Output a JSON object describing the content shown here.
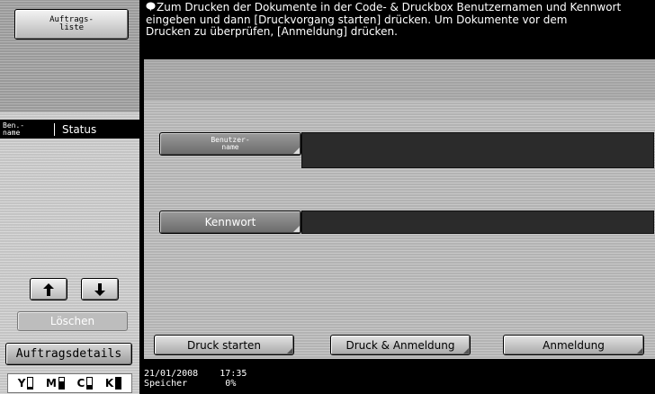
{
  "left_panel": {
    "job_list_button": "Auftrags-\nliste",
    "list_header": {
      "col1": "Ben.-\nname",
      "col2": "Status"
    },
    "delete_button": "Löschen",
    "details_button": "Auftragsdetails",
    "toner": [
      {
        "label": "Y",
        "level": 0.2
      },
      {
        "label": "M",
        "level": 0.65
      },
      {
        "label": "C",
        "level": 0.3
      },
      {
        "label": "K",
        "level": 1.0
      }
    ]
  },
  "message": {
    "text": "Zum Drucken der Dokumente in der Code- & Druckbox Benutzernamen und Kennwort\neingeben und dann [Druckvorgang starten] drücken. Um Dokumente vor dem\nDrucken zu überprüfen, [Anmeldung] drücken."
  },
  "form": {
    "username_label": "Benutzer-\nname",
    "username_value": "",
    "password_label": "Kennwort",
    "password_value": ""
  },
  "actions": {
    "print_start": "Druck starten",
    "print_and_login": "Druck & Anmeldung",
    "login": "Anmeldung"
  },
  "status_bar": {
    "datetime": "21/01/2008    17:35",
    "memory": "Speicher       0%"
  },
  "colors": {
    "background": "#000000",
    "panel": "#b3b3b3",
    "input": "#2b2b2b"
  }
}
